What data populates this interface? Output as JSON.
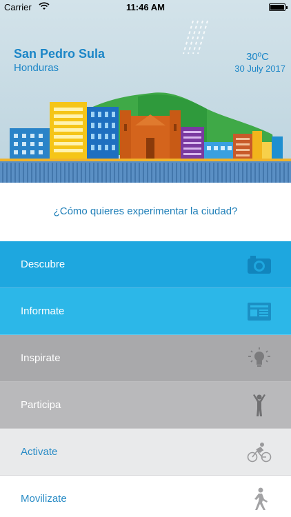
{
  "status_bar": {
    "carrier": "Carrier",
    "time": "11:46 AM"
  },
  "header": {
    "city": "San Pedro Sula",
    "country": "Honduras",
    "temperature": "30ºC",
    "date": "30 July 2017",
    "weather_icon": "rain-icon"
  },
  "prompt": "¿Cómo quieres experimentar la ciudad?",
  "menu": [
    {
      "label": "Descubre",
      "icon": "camera-icon"
    },
    {
      "label": "Informate",
      "icon": "newspaper-icon"
    },
    {
      "label": "Inspirate",
      "icon": "lightbulb-icon"
    },
    {
      "label": "Participa",
      "icon": "person-arms-up-icon"
    },
    {
      "label": "Activate",
      "icon": "cyclist-icon"
    },
    {
      "label": "Movilizate",
      "icon": "walking-icon"
    }
  ],
  "colors": {
    "accent": "#1c86c7",
    "descubre": "#1ea7df",
    "informate": "#2cb7e8",
    "inspirate": "#a9a9ab",
    "participa": "#b9b9bb",
    "activate": "#e9eaeb",
    "movilizate": "#ffffff"
  }
}
